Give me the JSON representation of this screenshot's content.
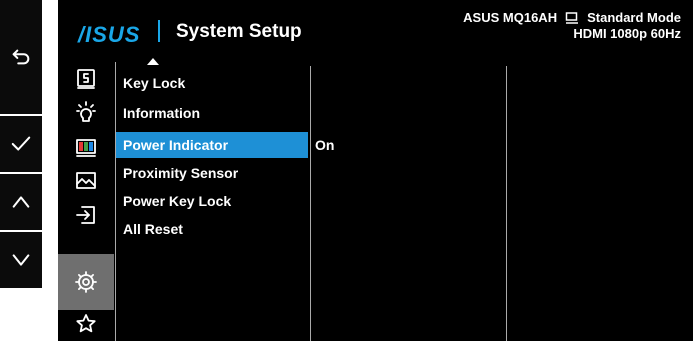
{
  "header": {
    "logo": "/ISUS",
    "title": "System Setup",
    "model": "ASUS MQ16AH",
    "mode": "Standard Mode",
    "signal": "HDMI 1080p 60Hz"
  },
  "side_buttons": [
    {
      "icon": "return-icon"
    },
    {
      "icon": "check-icon"
    },
    {
      "icon": "chevron-up-icon"
    },
    {
      "icon": "chevron-down-icon"
    }
  ],
  "categories": [
    {
      "icon": "splendid-icon",
      "active": false
    },
    {
      "icon": "brightness-icon",
      "active": false
    },
    {
      "icon": "color-icon",
      "active": false
    },
    {
      "icon": "image-icon",
      "active": false
    },
    {
      "icon": "input-select-icon",
      "active": false
    },
    {
      "icon": "gear-icon",
      "active": true
    },
    {
      "icon": "star-icon",
      "active": false
    }
  ],
  "menu_items": [
    {
      "label": "Key Lock",
      "selected": false
    },
    {
      "label": "Information",
      "selected": false
    },
    {
      "label": "Power Indicator",
      "selected": true
    },
    {
      "label": "Proximity Sensor",
      "selected": false
    },
    {
      "label": "Power Key Lock",
      "selected": false
    },
    {
      "label": "All Reset",
      "selected": false
    }
  ],
  "selected_value": "On",
  "colors": {
    "accent": "#1e90d6",
    "logo": "#1aa7e8",
    "active_category": "#6f6f6f",
    "background": "#000000"
  }
}
